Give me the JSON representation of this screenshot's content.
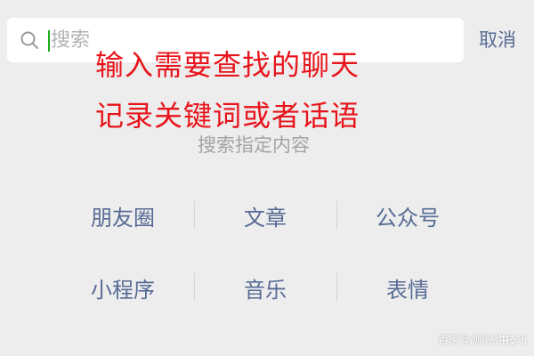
{
  "search": {
    "placeholder": "搜索",
    "value": "",
    "cancel_label": "取消"
  },
  "annotation": {
    "line1": "输入需要查找的聊天",
    "line2": "记录关键词或者话语",
    "color": "#e8141b"
  },
  "section_title": "搜索指定内容",
  "categories": [
    [
      "朋友圈",
      "文章",
      "公众号"
    ],
    [
      "小程序",
      "音乐",
      "表情"
    ]
  ],
  "watermark": "百家号/师兄讲技巧",
  "colors": {
    "background": "#ededed",
    "link": "#576b95",
    "cursor": "#1aad19",
    "muted": "#a3a3a3"
  },
  "icons": {
    "search": "search-icon"
  }
}
